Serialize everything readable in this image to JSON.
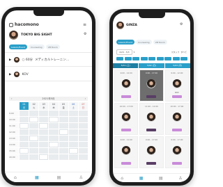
{
  "left_phone": {
    "app_name": "hacomono",
    "venue_title": "TOKYO BIG SIGHT",
    "tabs": [
      "Lesson/Event",
      "Counseling",
      "VIP Room"
    ],
    "list_items": [
      {
        "time": "○ 60分",
        "label": "メディカルトレーニン…"
      },
      {
        "time": "",
        "label": "KOV"
      }
    ],
    "month_label": "2021年5月",
    "days": [
      {
        "num": "01",
        "dow": "月"
      },
      {
        "num": "02",
        "dow": "火"
      },
      {
        "num": "03",
        "dow": "水"
      },
      {
        "num": "04",
        "dow": "木"
      },
      {
        "num": "05",
        "dow": "金"
      },
      {
        "num": "06",
        "dow": "土"
      },
      {
        "num": "07",
        "dow": "日"
      }
    ],
    "times": [
      "9:00",
      "10:00",
      "11:00",
      "12:00",
      "13:00",
      "14:00",
      "15:00",
      "16:00"
    ]
  },
  "right_phone": {
    "venue_title": "GINZA",
    "tabs": [
      "Lesson/Event",
      "Counseling",
      "VIP Room"
    ],
    "filter_select": "4/29 - 5/3",
    "filter_links": [
      "スタッフ",
      "すべて"
    ],
    "chips": [
      "",
      "",
      "",
      "",
      "",
      "",
      "",
      "",
      ""
    ],
    "dates": [
      "5/01 (土)",
      "5/02 (日)",
      "5/03 (月)"
    ],
    "staff": [
      {
        "time": "9:00 - 12:00",
        "name": "",
        "selected": false
      },
      {
        "time": "9:00 - 17:00",
        "name": "",
        "selected": true
      },
      {
        "time": "9:00 - 12:00",
        "name": "KOV",
        "selected": false
      },
      {
        "time": "10:00 - 17:00",
        "name": "",
        "selected": false
      },
      {
        "time": "11:00 - 12:00",
        "name": "",
        "selected": false
      },
      {
        "time": "10:00 - 17:00",
        "name": "",
        "selected": false
      },
      {
        "time": "9:00 - 11:00",
        "name": "",
        "selected": false
      },
      {
        "time": "9:00 - 17:00",
        "name": "",
        "selected": false
      },
      {
        "time": "9:00 - 17:00",
        "name": "",
        "selected": false
      }
    ]
  }
}
